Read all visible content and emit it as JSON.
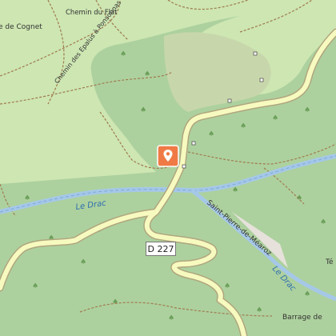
{
  "map": {
    "labels": {
      "cognet": "e de Cognet",
      "flat": "Chemin du Flat",
      "epalus": "Chemin des Epalus à Ponsonnas",
      "drac_west": "Le Drac",
      "saint_pierre": "Saint-Pierre-de-Méaroz",
      "drac_east": "Le Drac",
      "barrage": "Barrage de",
      "te": "Té"
    },
    "road_ref": "D 227",
    "marker_icon": "map-pin-icon",
    "colors": {
      "forest": "#add19e",
      "meadow": "#cde6b2",
      "scrub": "#c8d7ab",
      "river": "#a5c8e8",
      "road": "#f7fabf",
      "road_casing": "#b0a67f",
      "marker": "#f07a45"
    }
  }
}
